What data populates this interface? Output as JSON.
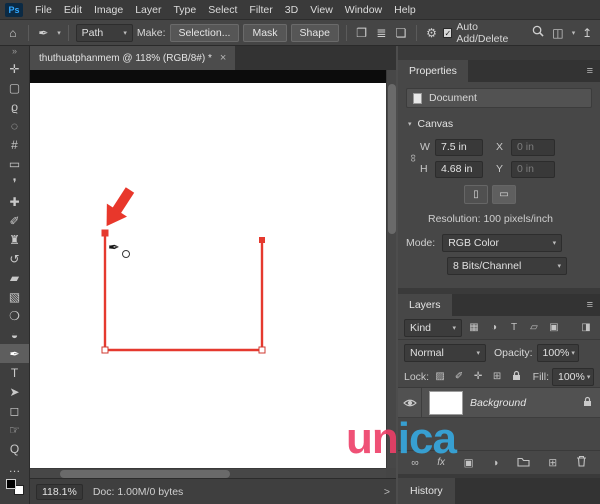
{
  "menubar": {
    "logo": "Ps",
    "items": [
      "File",
      "Edit",
      "Image",
      "Layer",
      "Type",
      "Select",
      "Filter",
      "3D",
      "View",
      "Window",
      "Help"
    ]
  },
  "options_bar": {
    "home_icon": "⌂",
    "active_tool_icon": "✒",
    "caret": "▾",
    "path_mode": "Path",
    "make_label": "Make:",
    "selection_button": "Selection...",
    "mask_button": "Mask",
    "shape_button": "Shape",
    "path_ops_icon": "❐",
    "align_icon": "≣",
    "arrange_icon": "❏",
    "gear_icon": "⚙",
    "auto_add_delete_check": "✓",
    "auto_add_delete_label": "Auto Add/Delete",
    "workspace_icon": "◫",
    "share_icon": "↥"
  },
  "document_tab": {
    "title": "thuthuatphanmem @ 118% (RGB/8#) *",
    "close": "×"
  },
  "toolbar": {
    "collapse_icon": "»",
    "more_icon": "…",
    "tools": [
      {
        "name": "move-tool",
        "glyph": "✛"
      },
      {
        "name": "marquee-tool",
        "glyph": "▢"
      },
      {
        "name": "lasso-tool",
        "glyph": "ϱ"
      },
      {
        "name": "quick-selection-tool",
        "glyph": "◌"
      },
      {
        "name": "crop-tool",
        "glyph": "#"
      },
      {
        "name": "frame-tool",
        "glyph": "▭"
      },
      {
        "name": "eyedropper-tool",
        "glyph": "❜"
      },
      {
        "name": "healing-brush-tool",
        "glyph": "✚"
      },
      {
        "name": "brush-tool",
        "glyph": "✐"
      },
      {
        "name": "clone-stamp-tool",
        "glyph": "♜"
      },
      {
        "name": "history-brush-tool",
        "glyph": "↺"
      },
      {
        "name": "eraser-tool",
        "glyph": "▰"
      },
      {
        "name": "gradient-tool",
        "glyph": "▧"
      },
      {
        "name": "blur-tool",
        "glyph": "❍"
      },
      {
        "name": "dodge-tool",
        "glyph": "◒"
      },
      {
        "name": "pen-tool",
        "glyph": "✒"
      },
      {
        "name": "type-tool",
        "glyph": "T"
      },
      {
        "name": "path-selection-tool",
        "glyph": "➤"
      },
      {
        "name": "shape-tool",
        "glyph": "◻"
      },
      {
        "name": "hand-tool",
        "glyph": "☞"
      },
      {
        "name": "zoom-tool",
        "glyph": "Q"
      }
    ]
  },
  "canvas": {
    "path_color": "#e5392e",
    "arrow_color": "#e8372b"
  },
  "properties": {
    "tab": "Properties",
    "menu_icon": "≡",
    "document_label": "Document",
    "section_chevron": "▾",
    "section_title": "Canvas",
    "link_icon": "∞",
    "w_label": "W",
    "w_value": "7.5 in",
    "x_label": "X",
    "x_value": "0 in",
    "h_label": "H",
    "h_value": "4.68 in",
    "y_label": "Y",
    "y_value": "0 in",
    "portrait_icon": "▯",
    "landscape_icon": "▭",
    "resolution": "Resolution: 100 pixels/inch",
    "mode_label": "Mode:",
    "mode_value": "RGB Color",
    "depth_value": "8 Bits/Channel",
    "select_caret": "▾"
  },
  "layers": {
    "tab": "Layers",
    "kind_label": "Kind",
    "filter_icons": {
      "pixel": "▦",
      "adjustment": "◑",
      "type": "T",
      "shape": "▱",
      "smart": "▣",
      "toggle": "◨"
    },
    "blend_mode": "Normal",
    "opacity_label": "Opacity:",
    "opacity_value": "100%",
    "lock_label": "Lock:",
    "lock_icons": {
      "transparency": "▨",
      "pixels": "✐",
      "position": "✛",
      "artboard": "⊞"
    },
    "fill_label": "Fill:",
    "fill_value": "100%",
    "layer_name": "Background",
    "bottom_icons": {
      "link": "∞",
      "fx": "fx",
      "mask": "▣",
      "adjust": "◑",
      "new_layer": "⊞"
    }
  },
  "history": {
    "tab": "History"
  },
  "status_bar": {
    "zoom": "118.1%",
    "doc": "Doc: 1.00M/0 bytes",
    "flyout": ">"
  },
  "watermark": {
    "left": "un",
    "right": "ica",
    "left_color": "#ee3f68",
    "right_color": "#36a9e1"
  }
}
